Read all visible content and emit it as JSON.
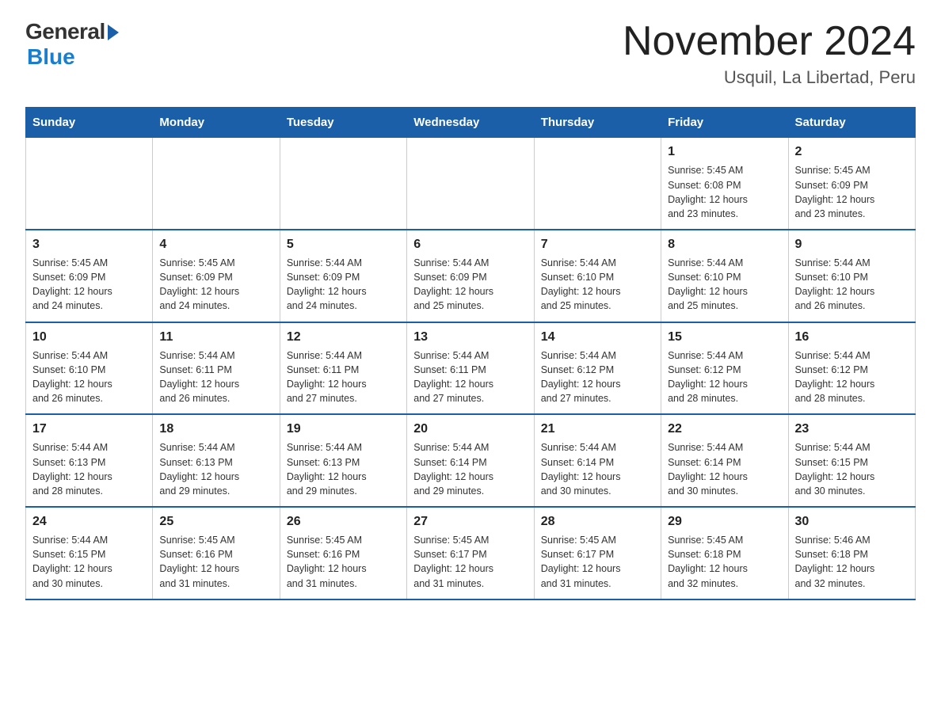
{
  "header": {
    "title": "November 2024",
    "subtitle": "Usquil, La Libertad, Peru",
    "logo_general": "General",
    "logo_blue": "Blue"
  },
  "weekdays": [
    "Sunday",
    "Monday",
    "Tuesday",
    "Wednesday",
    "Thursday",
    "Friday",
    "Saturday"
  ],
  "weeks": [
    [
      {
        "day": "",
        "info": ""
      },
      {
        "day": "",
        "info": ""
      },
      {
        "day": "",
        "info": ""
      },
      {
        "day": "",
        "info": ""
      },
      {
        "day": "",
        "info": ""
      },
      {
        "day": "1",
        "info": "Sunrise: 5:45 AM\nSunset: 6:08 PM\nDaylight: 12 hours\nand 23 minutes."
      },
      {
        "day": "2",
        "info": "Sunrise: 5:45 AM\nSunset: 6:09 PM\nDaylight: 12 hours\nand 23 minutes."
      }
    ],
    [
      {
        "day": "3",
        "info": "Sunrise: 5:45 AM\nSunset: 6:09 PM\nDaylight: 12 hours\nand 24 minutes."
      },
      {
        "day": "4",
        "info": "Sunrise: 5:45 AM\nSunset: 6:09 PM\nDaylight: 12 hours\nand 24 minutes."
      },
      {
        "day": "5",
        "info": "Sunrise: 5:44 AM\nSunset: 6:09 PM\nDaylight: 12 hours\nand 24 minutes."
      },
      {
        "day": "6",
        "info": "Sunrise: 5:44 AM\nSunset: 6:09 PM\nDaylight: 12 hours\nand 25 minutes."
      },
      {
        "day": "7",
        "info": "Sunrise: 5:44 AM\nSunset: 6:10 PM\nDaylight: 12 hours\nand 25 minutes."
      },
      {
        "day": "8",
        "info": "Sunrise: 5:44 AM\nSunset: 6:10 PM\nDaylight: 12 hours\nand 25 minutes."
      },
      {
        "day": "9",
        "info": "Sunrise: 5:44 AM\nSunset: 6:10 PM\nDaylight: 12 hours\nand 26 minutes."
      }
    ],
    [
      {
        "day": "10",
        "info": "Sunrise: 5:44 AM\nSunset: 6:10 PM\nDaylight: 12 hours\nand 26 minutes."
      },
      {
        "day": "11",
        "info": "Sunrise: 5:44 AM\nSunset: 6:11 PM\nDaylight: 12 hours\nand 26 minutes."
      },
      {
        "day": "12",
        "info": "Sunrise: 5:44 AM\nSunset: 6:11 PM\nDaylight: 12 hours\nand 27 minutes."
      },
      {
        "day": "13",
        "info": "Sunrise: 5:44 AM\nSunset: 6:11 PM\nDaylight: 12 hours\nand 27 minutes."
      },
      {
        "day": "14",
        "info": "Sunrise: 5:44 AM\nSunset: 6:12 PM\nDaylight: 12 hours\nand 27 minutes."
      },
      {
        "day": "15",
        "info": "Sunrise: 5:44 AM\nSunset: 6:12 PM\nDaylight: 12 hours\nand 28 minutes."
      },
      {
        "day": "16",
        "info": "Sunrise: 5:44 AM\nSunset: 6:12 PM\nDaylight: 12 hours\nand 28 minutes."
      }
    ],
    [
      {
        "day": "17",
        "info": "Sunrise: 5:44 AM\nSunset: 6:13 PM\nDaylight: 12 hours\nand 28 minutes."
      },
      {
        "day": "18",
        "info": "Sunrise: 5:44 AM\nSunset: 6:13 PM\nDaylight: 12 hours\nand 29 minutes."
      },
      {
        "day": "19",
        "info": "Sunrise: 5:44 AM\nSunset: 6:13 PM\nDaylight: 12 hours\nand 29 minutes."
      },
      {
        "day": "20",
        "info": "Sunrise: 5:44 AM\nSunset: 6:14 PM\nDaylight: 12 hours\nand 29 minutes."
      },
      {
        "day": "21",
        "info": "Sunrise: 5:44 AM\nSunset: 6:14 PM\nDaylight: 12 hours\nand 30 minutes."
      },
      {
        "day": "22",
        "info": "Sunrise: 5:44 AM\nSunset: 6:14 PM\nDaylight: 12 hours\nand 30 minutes."
      },
      {
        "day": "23",
        "info": "Sunrise: 5:44 AM\nSunset: 6:15 PM\nDaylight: 12 hours\nand 30 minutes."
      }
    ],
    [
      {
        "day": "24",
        "info": "Sunrise: 5:44 AM\nSunset: 6:15 PM\nDaylight: 12 hours\nand 30 minutes."
      },
      {
        "day": "25",
        "info": "Sunrise: 5:45 AM\nSunset: 6:16 PM\nDaylight: 12 hours\nand 31 minutes."
      },
      {
        "day": "26",
        "info": "Sunrise: 5:45 AM\nSunset: 6:16 PM\nDaylight: 12 hours\nand 31 minutes."
      },
      {
        "day": "27",
        "info": "Sunrise: 5:45 AM\nSunset: 6:17 PM\nDaylight: 12 hours\nand 31 minutes."
      },
      {
        "day": "28",
        "info": "Sunrise: 5:45 AM\nSunset: 6:17 PM\nDaylight: 12 hours\nand 31 minutes."
      },
      {
        "day": "29",
        "info": "Sunrise: 5:45 AM\nSunset: 6:18 PM\nDaylight: 12 hours\nand 32 minutes."
      },
      {
        "day": "30",
        "info": "Sunrise: 5:46 AM\nSunset: 6:18 PM\nDaylight: 12 hours\nand 32 minutes."
      }
    ]
  ]
}
